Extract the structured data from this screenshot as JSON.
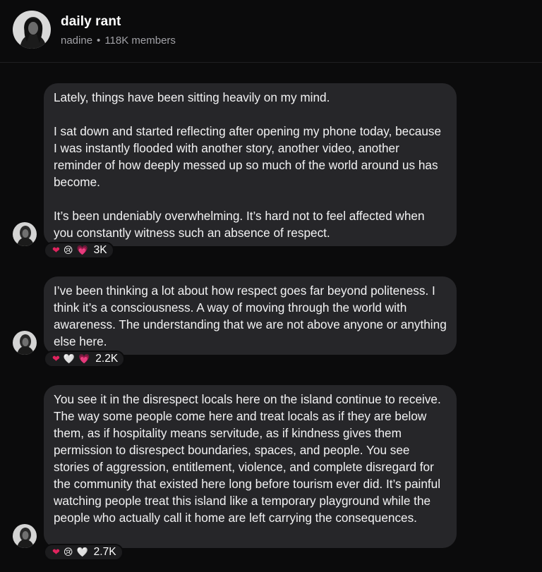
{
  "header": {
    "title": "daily rant",
    "owner": "nadine",
    "separator": "•",
    "members": "118K members",
    "avatar_icon": "profile-photo-icon"
  },
  "messages": [
    {
      "paragraphs": [
        "Lately, things have been sitting heavily on my mind.",
        "I sat down and started reflecting after opening my phone today, because I was instantly flooded with another story, another video, another reminder of how deeply messed up so much of the world around us has become.",
        "It’s been undeniably overwhelming. It’s hard not to feel affected when you constantly witness such an absence of respect."
      ],
      "reactions": [
        "❤",
        "😢",
        "💗"
      ],
      "reaction_count": "3K"
    },
    {
      "paragraphs": [
        "I’ve been thinking a lot about how respect goes far beyond politeness. I think it’s a consciousness. A way of moving through the world with awareness. The understanding that we are not above anyone or anything else here."
      ],
      "reactions": [
        "❤",
        "🤍",
        "💗"
      ],
      "reaction_count": "2.2K"
    },
    {
      "paragraphs": [
        "You see it in the disrespect locals here on the island continue to receive. The way some people come here and treat locals as if they are below them, as if hospitality means servitude, as if kindness gives them permission to disrespect boundaries, spaces, and people. You see stories of aggression, entitlement, violence, and complete disregard for the community that existed here long before tourism ever did. It’s painful watching people treat this island like a temporary playground while the people who actually call it home are left carrying the consequences."
      ],
      "reactions": [
        "❤",
        "😢",
        "🤍"
      ],
      "reaction_count": "2.7K"
    }
  ],
  "colors": {
    "background": "#0b0b0c",
    "bubble": "#262629",
    "heart_red": "#e0245e",
    "heart_pink": "#ff4fb0",
    "meta_text": "#a1a1a6"
  }
}
